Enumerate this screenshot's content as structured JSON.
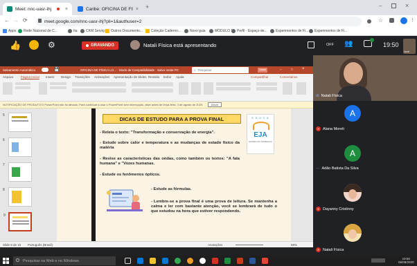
{
  "browser": {
    "tabs": [
      {
        "label": "Meet: nnc-uasr-ihj",
        "favicon_color": "#00897b"
      },
      {
        "label": "Caribe: OFICINA DE FÍSICA LO...",
        "favicon_color": "#1a73e8"
      }
    ],
    "url": "meet.google.com/nnc-uasr-ihj?pli=1&authuser=2",
    "bookmarks": [
      "Apps",
      "Rede Nacional de C...",
      "Ita",
      "CKM Serviços",
      "Outros Documento...",
      "Coleção Caderno...",
      "Novo guia",
      "MÓDULO 1",
      "Perfil - Espaço de...",
      "Experimentos de Fi...",
      "Experimentos de Fi..."
    ]
  },
  "meet": {
    "recording_label": "GRAVANDO",
    "presenter_text": "Natali Física está apresentando",
    "time": "19:50",
    "toolbar_off": "OFF",
    "self_label": "Você"
  },
  "ppt": {
    "title_left": "Salvamento Automático",
    "title_center": "OFICINA DE FÍSICA LO... · Modo de Compatibilidade · Salvo neste PC",
    "search_placeholder": "Pesquisar",
    "user": "Natali",
    "menu": [
      "Arquivo",
      "Página Inicial",
      "Inserir",
      "Design",
      "Transições",
      "Animações",
      "Apresentação de Slides",
      "Revisão",
      "Exibir",
      "Ajuda"
    ],
    "menu_right": [
      "Compartilhar",
      "Comentários"
    ],
    "notice": "NOTIFICAÇÃO DE PRODUTO   O PowerPoint não foi ativado. Para continuar a usar o PowerPoint sem interrupção, ative antes de terça-feira, 4 de agosto de 2020.",
    "notice_button": "Ativar",
    "thumb_numbers": [
      "5",
      "6",
      "7",
      "8",
      "9"
    ],
    "status_left": "Slide 9 de 10",
    "status_lang": "Português (Brasil)",
    "status_right": "Anotações",
    "zoom": "68%",
    "slide": {
      "title": "DICAS DE ESTUDO PARA A PROVA FINAL",
      "bullets": [
        "- Releia o texto: \"Transformação e conservação de energia\".",
        "- Estude sobre calor e temperatura e as mudanças de estado físico da matéria",
        "- Revise as características das ondas, como também os textos: \"A fala humana\" e \"Vozes humanas.",
        "- Estude os fenômenos ópticos."
      ],
      "sub1": "- Estude as fórmulas.",
      "sub2": "- Lembre-se a prova final é uma prova de leitura. Se mantenha a calma e ler com bastante atenção, você se lembrará de tudo o que estudou na hora que estiver respondendo.",
      "logo_top": "E D U C A",
      "logo_text": "EJA",
      "logo_sub": "MUNDO DO TRABALHO"
    }
  },
  "participants": [
    {
      "name": "Natali Física",
      "type": "camera"
    },
    {
      "name": "Alana Moreti",
      "type": "avatar",
      "initial": "A",
      "color": "#1a73e8"
    },
    {
      "name": "Adão Batista Da Silva",
      "type": "avatar",
      "initial": "A",
      "color": "#1e8e3e"
    },
    {
      "name": "Dayanny Cristinny",
      "type": "photo"
    },
    {
      "name": "Natali Física",
      "type": "photo"
    }
  ],
  "taskbar": {
    "search_placeholder": "Pesquisar na Web e no Windows",
    "time": "19:50",
    "date": "06/08/2020"
  }
}
